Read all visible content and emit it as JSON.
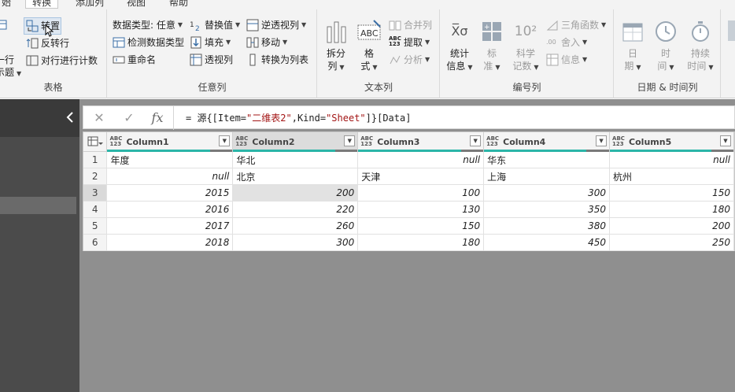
{
  "tabs": [
    {
      "label": "始",
      "active": false
    },
    {
      "label": "转换",
      "active": true
    },
    {
      "label": "添加列",
      "active": false
    },
    {
      "label": "视图",
      "active": false
    },
    {
      "label": "帮助",
      "active": false
    }
  ],
  "ribbon": {
    "table_group": {
      "label": "表格",
      "transpose": "转置",
      "reverse_rows": "反转行",
      "count_rows": "对行进行计数",
      "first_row_header_line1": "一行",
      "first_row_header_line2": "示题"
    },
    "any_column_group": {
      "label": "任意列",
      "data_type": "数据类型: 任意",
      "detect_type": "检测数据类型",
      "rename": "重命名",
      "replace_values": "替换值",
      "fill": "填充",
      "pivot": "透视列",
      "unpivot": "逆透视列",
      "move": "移动",
      "to_list": "转换为列表"
    },
    "text_column_group": {
      "label": "文本列",
      "split_line1": "拆分",
      "split_line2": "列",
      "format_line1": "格",
      "format_line2": "式",
      "merge": "合并列",
      "extract": "提取",
      "parse": "分析",
      "abc_icon": "ABC",
      "abc123_icon_top": "ABC",
      "abc123_icon_bottom": "123"
    },
    "number_column_group": {
      "label": "编号列",
      "stats_line1": "统计",
      "stats_line2": "信息",
      "standard_line1": "标",
      "standard_line2": "准",
      "scientific_line1": "科学",
      "scientific_line2": "记数",
      "sci_icon": "10²",
      "trig": "三角函数",
      "rounding": "舍入",
      "info": "信息",
      "rounding_icon": ".00",
      "sigma_icon": "X̅σ"
    },
    "datetime_group": {
      "label": "日期 & 时间列",
      "date_line1": "日",
      "date_line2": "期",
      "time_line1": "时",
      "time_line2": "间",
      "duration_line1": "持续",
      "duration_line2": "时间"
    }
  },
  "formula": {
    "cancel": "✕",
    "confirm": "✓",
    "fx": "fx",
    "prefix": "= 源{[Item=",
    "item_str": "\"二维表2\"",
    "mid": ",Kind=",
    "kind_str": "\"Sheet\"",
    "suffix": "]}[Data]"
  },
  "table": {
    "type_top": "ABC",
    "type_bottom": "123",
    "columns": [
      "Column1",
      "Column2",
      "Column3",
      "Column4",
      "Column5"
    ],
    "rows": [
      {
        "n": "1",
        "cells": [
          {
            "v": "年度",
            "t": "text"
          },
          {
            "v": "华北",
            "t": "text"
          },
          {
            "v": "null",
            "t": "null"
          },
          {
            "v": "华东",
            "t": "text"
          },
          {
            "v": "null",
            "t": "null"
          }
        ]
      },
      {
        "n": "2",
        "cells": [
          {
            "v": "null",
            "t": "null"
          },
          {
            "v": "北京",
            "t": "text"
          },
          {
            "v": "天津",
            "t": "text"
          },
          {
            "v": "上海",
            "t": "text"
          },
          {
            "v": "杭州",
            "t": "text"
          }
        ]
      },
      {
        "n": "3",
        "cells": [
          {
            "v": "2015",
            "t": "num"
          },
          {
            "v": "200",
            "t": "num"
          },
          {
            "v": "100",
            "t": "num"
          },
          {
            "v": "300",
            "t": "num"
          },
          {
            "v": "150",
            "t": "num"
          }
        ]
      },
      {
        "n": "4",
        "cells": [
          {
            "v": "2016",
            "t": "num"
          },
          {
            "v": "220",
            "t": "num"
          },
          {
            "v": "130",
            "t": "num"
          },
          {
            "v": "350",
            "t": "num"
          },
          {
            "v": "180",
            "t": "num"
          }
        ]
      },
      {
        "n": "5",
        "cells": [
          {
            "v": "2017",
            "t": "num"
          },
          {
            "v": "260",
            "t": "num"
          },
          {
            "v": "150",
            "t": "num"
          },
          {
            "v": "380",
            "t": "num"
          },
          {
            "v": "200",
            "t": "num"
          }
        ]
      },
      {
        "n": "6",
        "cells": [
          {
            "v": "2018",
            "t": "num"
          },
          {
            "v": "300",
            "t": "num"
          },
          {
            "v": "180",
            "t": "num"
          },
          {
            "v": "450",
            "t": "num"
          },
          {
            "v": "250",
            "t": "num"
          }
        ]
      }
    ]
  },
  "colors": {
    "quality_bar": "#2bb5a8",
    "nav_bg": "#4b4b4b",
    "main_bg": "#8f8f8f"
  }
}
